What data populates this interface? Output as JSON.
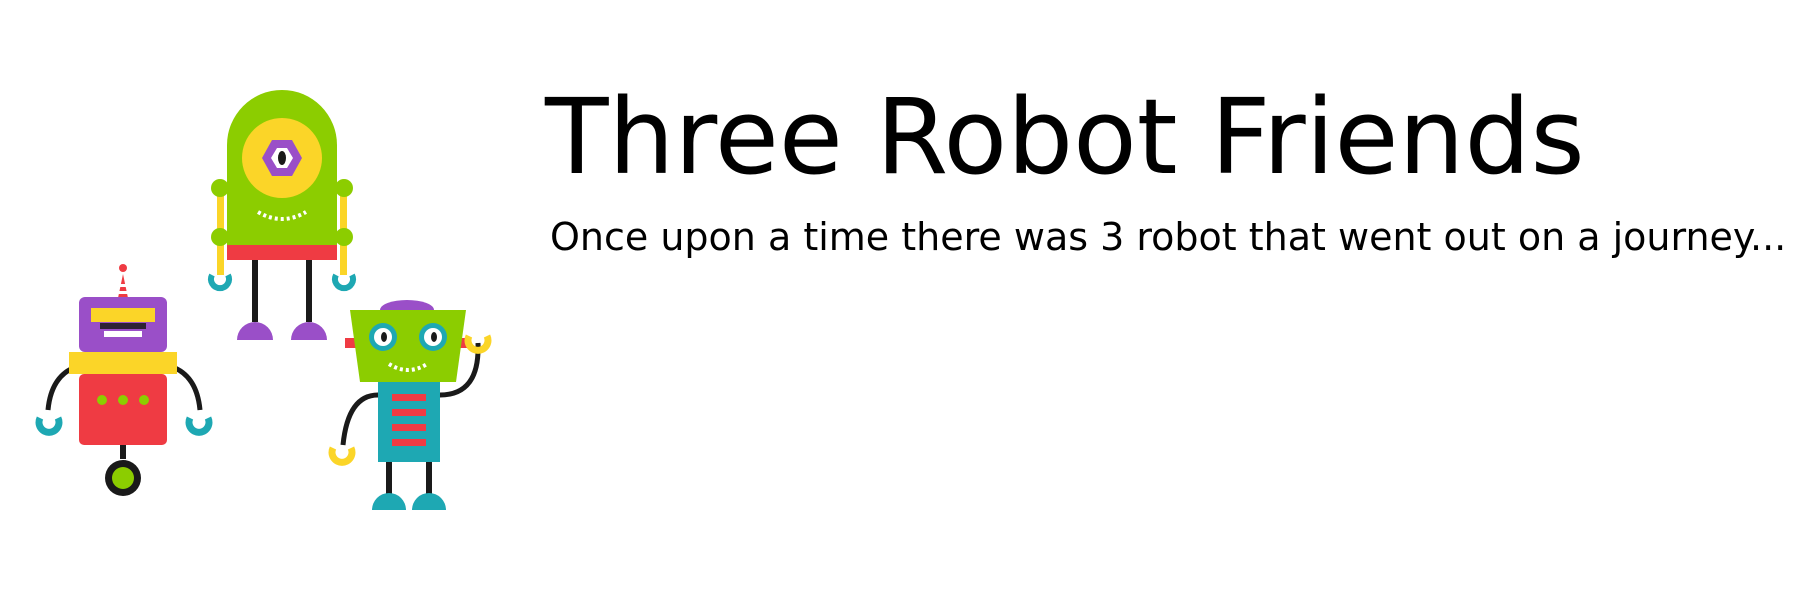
{
  "title": "Three Robot Friends",
  "subtitle": "Once upon a time there was 3 robot that went out on a journey...",
  "colors": {
    "green": "#8ccd00",
    "purple": "#9a4fc8",
    "yellow": "#fbd528",
    "red": "#ef3b43",
    "teal": "#1ea8b3",
    "dark": "#1a1a1a"
  },
  "icons": [
    "green-cyclops-robot-icon",
    "purple-red-wheel-robot-icon",
    "teal-waving-robot-icon"
  ]
}
